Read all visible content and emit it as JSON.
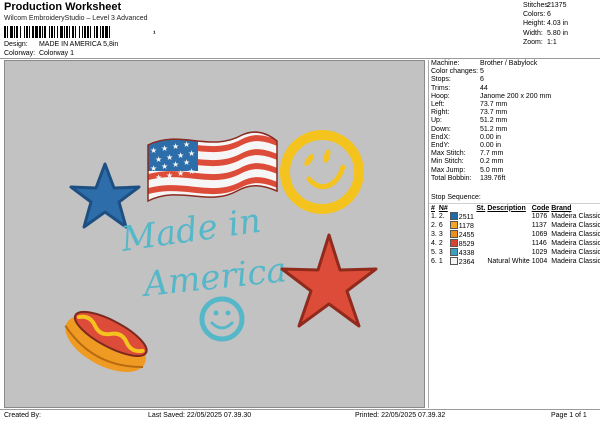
{
  "header": {
    "title": "Production Worksheet",
    "subtitle": "Wilcom EmbroideryStudio – Level 3 Advanced",
    "barcode_tail": "¹"
  },
  "design": {
    "label": "Design:",
    "value": "MADE IN AMERICA 5,8in"
  },
  "colorway": {
    "label": "Colorway:",
    "value": "Colorway 1"
  },
  "stats": [
    {
      "label": "Stitches:",
      "value": "21375"
    },
    {
      "label": "Colors:",
      "value": "6"
    },
    {
      "label": "Height:",
      "value": "4.03 in"
    },
    {
      "label": "Width:",
      "value": "5.80 in"
    },
    {
      "label": "Zoom:",
      "value": "1:1"
    }
  ],
  "machine_info": [
    {
      "label": "Machine:",
      "value": "Brother / Babylock"
    },
    {
      "label": "Color changes:",
      "value": "5"
    },
    {
      "label": "Stops:",
      "value": "6"
    },
    {
      "label": "Trims:",
      "value": "44"
    },
    {
      "label": "Hoop:",
      "value": "Janome 200 x 200 mm"
    },
    {
      "label": "Left:",
      "value": "73.7 mm"
    },
    {
      "label": "Right:",
      "value": "73.7 mm"
    },
    {
      "label": "Up:",
      "value": "51.2 mm"
    },
    {
      "label": "Down:",
      "value": "51.2 mm"
    },
    {
      "label": "EndX:",
      "value": "0.00 in"
    },
    {
      "label": "EndY:",
      "value": "0.00 in"
    },
    {
      "label": "Max Stitch:",
      "value": "7.7 mm"
    },
    {
      "label": "Min Stitch:",
      "value": "0.2 mm"
    },
    {
      "label": "Max Jump:",
      "value": "5.0 mm"
    },
    {
      "label": "Total Bobbin:",
      "value": "139.76ft"
    }
  ],
  "stop_sequence": {
    "label": "Stop Sequence:",
    "headers": [
      "#",
      "N#",
      "",
      "St.",
      "Description",
      "Code",
      "Brand"
    ],
    "rows": [
      {
        "num": "1.",
        "needle": "2.",
        "color": "#1f6aa8",
        "code_id": "2511",
        "stitches": "",
        "description": "",
        "code": "1076",
        "brand": "Madeira Classic 40"
      },
      {
        "num": "2.",
        "needle": "6",
        "color": "#f2a623",
        "code_id": "1178",
        "stitches": "",
        "description": "",
        "code": "1137",
        "brand": "Madeira Classic 40"
      },
      {
        "num": "3.",
        "needle": "3",
        "color": "#ec8f1c",
        "code_id": "2455",
        "stitches": "",
        "description": "",
        "code": "1069",
        "brand": "Madeira Classic 40"
      },
      {
        "num": "4.",
        "needle": "2",
        "color": "#d8432f",
        "code_id": "8529",
        "stitches": "",
        "description": "",
        "code": "1146",
        "brand": "Madeira Classic 40"
      },
      {
        "num": "5.",
        "needle": "3",
        "color": "#3aa0bf",
        "code_id": "4338",
        "stitches": "",
        "description": "",
        "code": "1029",
        "brand": "Madeira Classic 40"
      },
      {
        "num": "6.",
        "needle": "1",
        "color": "#f4f4f4",
        "code_id": "2364",
        "stitches": "",
        "description": "Natural White",
        "code": "1004",
        "brand": "Madeira Classic 40"
      }
    ]
  },
  "artwork": {
    "text_line1": "Made in",
    "text_line2": "America",
    "colors": {
      "blue": "#2d6eaa",
      "red": "#dd4c38",
      "yellow": "#f4c31e",
      "teal": "#56b7c9",
      "orange": "#ef9a22",
      "white": "#f6f6f6"
    }
  },
  "footer": {
    "created": "Created By:",
    "last_saved": "Last Saved: 22/05/2025 07.39.30",
    "printed": "Printed: 22/05/2025 07.39.32",
    "page": "Page 1 of 1"
  }
}
